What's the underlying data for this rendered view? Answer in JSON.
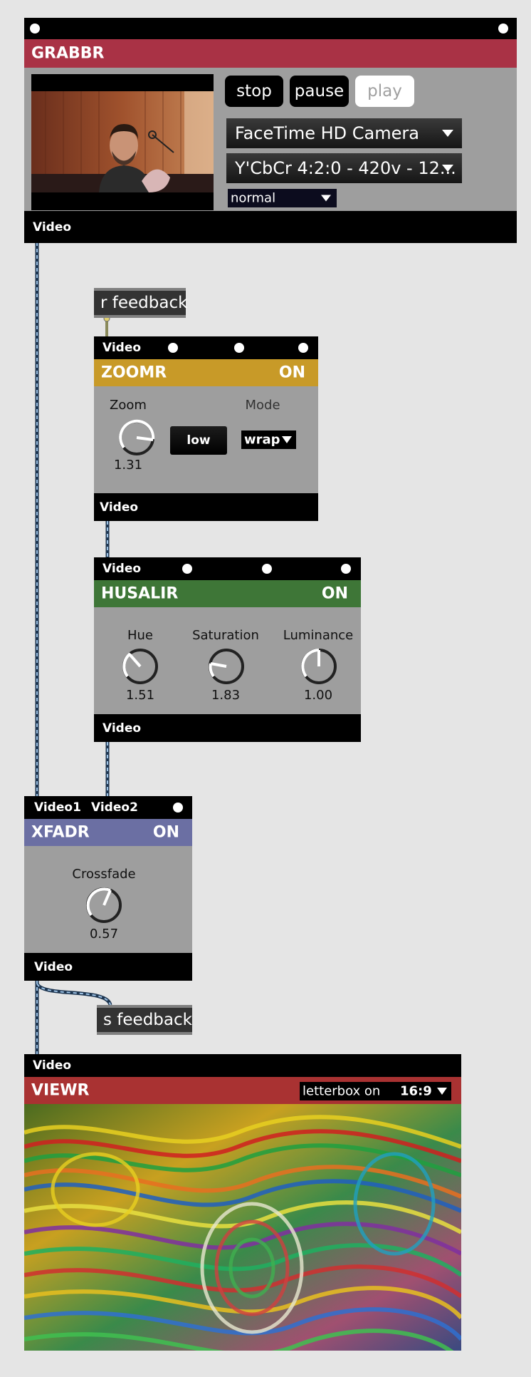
{
  "grabbr": {
    "title": "GRABBR",
    "outlet_label": "Video",
    "buttons": {
      "stop": "stop",
      "pause": "pause",
      "play": "play"
    },
    "camera_menu": "FaceTime HD Camera",
    "format_menu": "Y'CbCr 4:2:0 - 420v - 12...",
    "mode_menu": "normal",
    "colors": {
      "title_bg": "#a93245"
    }
  },
  "receive": {
    "label": "r feedback"
  },
  "zoomr": {
    "inlet_label": "Video",
    "title": "ZOOMR",
    "status": "ON",
    "zoom_label": "Zoom",
    "zoom_value": "1.31",
    "quality_button": "low",
    "mode_label": "Mode",
    "mode_menu": "wrap",
    "outlet_label": "Video",
    "colors": {
      "title_bg": "#c89a28"
    }
  },
  "husalir": {
    "inlet_label": "Video",
    "title": "HUSALIR",
    "status": "ON",
    "hue_label": "Hue",
    "hue_value": "1.51",
    "saturation_label": "Saturation",
    "saturation_value": "1.83",
    "luminance_label": "Luminance",
    "luminance_value": "1.00",
    "outlet_label": "Video",
    "colors": {
      "title_bg": "#3e7637"
    }
  },
  "xfadr": {
    "inlet1_label": "Video1",
    "inlet2_label": "Video2",
    "title": "XFADR",
    "status": "ON",
    "crossfade_label": "Crossfade",
    "crossfade_value": "0.57",
    "outlet_label": "Video",
    "colors": {
      "title_bg": "#6b6fa3"
    }
  },
  "send": {
    "label": "s feedback"
  },
  "viewr": {
    "inlet_label": "Video",
    "title": "VIEWR",
    "letterbox_menu": "letterbox on",
    "aspect_menu": "16:9",
    "colors": {
      "title_bg": "#a93232"
    }
  }
}
